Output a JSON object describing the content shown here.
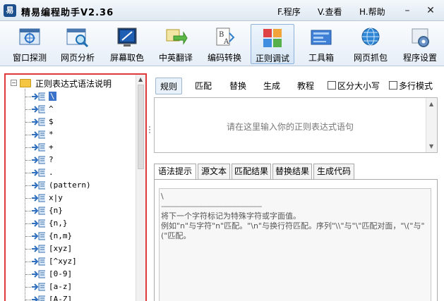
{
  "title_bar": {
    "app_title": "精易编程助手V2.36",
    "menus": [
      "F.程序",
      "V.查看",
      "H.帮助"
    ]
  },
  "toolbar": {
    "items": [
      {
        "label": "窗口探测",
        "icon": "window-probe-icon"
      },
      {
        "label": "网页分析",
        "icon": "web-analyze-icon"
      },
      {
        "label": "屏幕取色",
        "icon": "color-picker-icon"
      },
      {
        "label": "中英翻译",
        "icon": "translate-icon"
      },
      {
        "label": "编码转换",
        "icon": "encoding-icon"
      },
      {
        "label": "正则调试",
        "icon": "regex-debug-icon"
      },
      {
        "label": "工具箱",
        "icon": "toolbox-icon"
      },
      {
        "label": "网页抓包",
        "icon": "packet-capture-icon"
      },
      {
        "label": "程序设置",
        "icon": "settings-icon"
      }
    ],
    "active_index": 5
  },
  "tree": {
    "root": "正则表达式语法说明",
    "items": [
      "\\",
      "^",
      "$",
      "*",
      "+",
      "?",
      ".",
      "(pattern)",
      "x|y",
      "{n}",
      "{n,}",
      "{n,m}",
      "[xyz]",
      "[^xyz]",
      "[0-9]",
      "[a-z]",
      "[A-Z]"
    ],
    "selected_index": 0
  },
  "main_tabs": {
    "items": [
      "规则",
      "匹配",
      "替换",
      "生成",
      "教程"
    ],
    "active_index": 0,
    "checkboxes": [
      {
        "label": "区分大小写",
        "checked": false
      },
      {
        "label": "多行模式",
        "checked": false
      }
    ]
  },
  "regex_input": {
    "value": "",
    "placeholder": "请在这里输入你的正则表达式语句"
  },
  "result_tabs": {
    "items": [
      "语法提示",
      "源文本",
      "匹配结果",
      "替换结果",
      "生成代码"
    ],
    "active_index": 0
  },
  "syntax_hint": {
    "symbol": "\\",
    "separator": "------------------------------------------------",
    "line1": "将下一个字符标记为特殊字符或字面值。",
    "line2": "例如\"n\"与字符\"n\"匹配。\"\\n\"与换行符匹配。序列\"\\\\\"与\"\\\"匹配对面，\"\\(\"与\"(\"匹配。"
  },
  "colors": {
    "highlight_border": "#e0393c",
    "selection": "#3a73c9",
    "folder": "#f5c642"
  }
}
